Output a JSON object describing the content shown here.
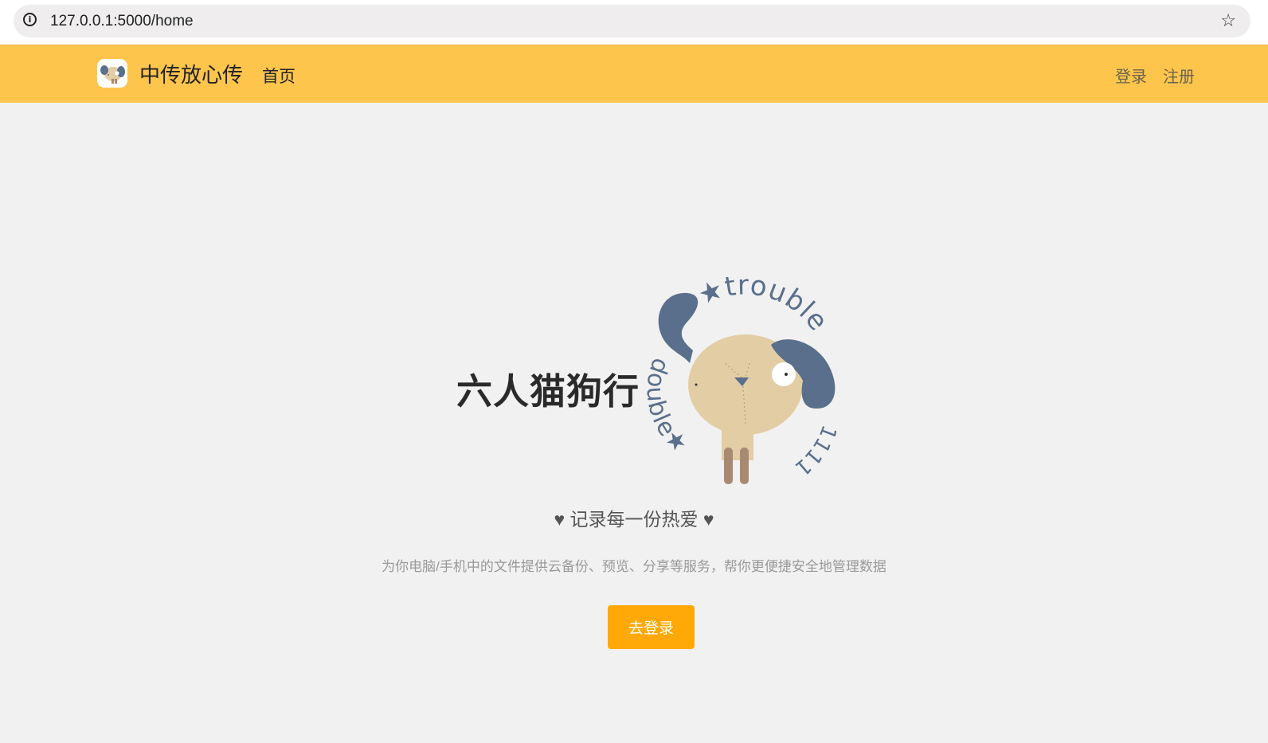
{
  "browser": {
    "url": "127.0.0.1:5000/home",
    "info_icon": "i"
  },
  "navbar": {
    "brand_name": "中传放心传",
    "home_label": "首页",
    "login_label": "登录",
    "register_label": "注册",
    "background": "#fdc54c"
  },
  "hero": {
    "title": "六人猫狗行",
    "logo_text_top": "★trouble",
    "logo_text_bottom": "double★",
    "logo_text_side": "1111",
    "tagline": "♥ 记录每一份热爱 ♥",
    "description": "为你电脑/手机中的文件提供云备份、预览、分享等服务，帮你更便捷安全地管理数据",
    "login_button_label": "去登录",
    "button_color": "#fea908"
  }
}
